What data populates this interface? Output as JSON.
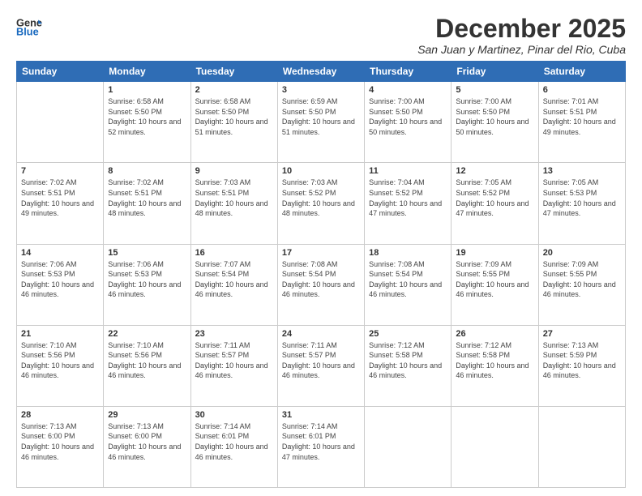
{
  "header": {
    "logo_general": "General",
    "logo_blue": "Blue",
    "month_title": "December 2025",
    "location": "San Juan y Martinez, Pinar del Rio, Cuba"
  },
  "days_of_week": [
    "Sunday",
    "Monday",
    "Tuesday",
    "Wednesday",
    "Thursday",
    "Friday",
    "Saturday"
  ],
  "weeks": [
    [
      {
        "day": "",
        "sunrise": "",
        "sunset": "",
        "daylight": ""
      },
      {
        "day": "1",
        "sunrise": "Sunrise: 6:58 AM",
        "sunset": "Sunset: 5:50 PM",
        "daylight": "Daylight: 10 hours and 52 minutes."
      },
      {
        "day": "2",
        "sunrise": "Sunrise: 6:58 AM",
        "sunset": "Sunset: 5:50 PM",
        "daylight": "Daylight: 10 hours and 51 minutes."
      },
      {
        "day": "3",
        "sunrise": "Sunrise: 6:59 AM",
        "sunset": "Sunset: 5:50 PM",
        "daylight": "Daylight: 10 hours and 51 minutes."
      },
      {
        "day": "4",
        "sunrise": "Sunrise: 7:00 AM",
        "sunset": "Sunset: 5:50 PM",
        "daylight": "Daylight: 10 hours and 50 minutes."
      },
      {
        "day": "5",
        "sunrise": "Sunrise: 7:00 AM",
        "sunset": "Sunset: 5:50 PM",
        "daylight": "Daylight: 10 hours and 50 minutes."
      },
      {
        "day": "6",
        "sunrise": "Sunrise: 7:01 AM",
        "sunset": "Sunset: 5:51 PM",
        "daylight": "Daylight: 10 hours and 49 minutes."
      }
    ],
    [
      {
        "day": "7",
        "sunrise": "Sunrise: 7:02 AM",
        "sunset": "Sunset: 5:51 PM",
        "daylight": "Daylight: 10 hours and 49 minutes."
      },
      {
        "day": "8",
        "sunrise": "Sunrise: 7:02 AM",
        "sunset": "Sunset: 5:51 PM",
        "daylight": "Daylight: 10 hours and 48 minutes."
      },
      {
        "day": "9",
        "sunrise": "Sunrise: 7:03 AM",
        "sunset": "Sunset: 5:51 PM",
        "daylight": "Daylight: 10 hours and 48 minutes."
      },
      {
        "day": "10",
        "sunrise": "Sunrise: 7:03 AM",
        "sunset": "Sunset: 5:52 PM",
        "daylight": "Daylight: 10 hours and 48 minutes."
      },
      {
        "day": "11",
        "sunrise": "Sunrise: 7:04 AM",
        "sunset": "Sunset: 5:52 PM",
        "daylight": "Daylight: 10 hours and 47 minutes."
      },
      {
        "day": "12",
        "sunrise": "Sunrise: 7:05 AM",
        "sunset": "Sunset: 5:52 PM",
        "daylight": "Daylight: 10 hours and 47 minutes."
      },
      {
        "day": "13",
        "sunrise": "Sunrise: 7:05 AM",
        "sunset": "Sunset: 5:53 PM",
        "daylight": "Daylight: 10 hours and 47 minutes."
      }
    ],
    [
      {
        "day": "14",
        "sunrise": "Sunrise: 7:06 AM",
        "sunset": "Sunset: 5:53 PM",
        "daylight": "Daylight: 10 hours and 46 minutes."
      },
      {
        "day": "15",
        "sunrise": "Sunrise: 7:06 AM",
        "sunset": "Sunset: 5:53 PM",
        "daylight": "Daylight: 10 hours and 46 minutes."
      },
      {
        "day": "16",
        "sunrise": "Sunrise: 7:07 AM",
        "sunset": "Sunset: 5:54 PM",
        "daylight": "Daylight: 10 hours and 46 minutes."
      },
      {
        "day": "17",
        "sunrise": "Sunrise: 7:08 AM",
        "sunset": "Sunset: 5:54 PM",
        "daylight": "Daylight: 10 hours and 46 minutes."
      },
      {
        "day": "18",
        "sunrise": "Sunrise: 7:08 AM",
        "sunset": "Sunset: 5:54 PM",
        "daylight": "Daylight: 10 hours and 46 minutes."
      },
      {
        "day": "19",
        "sunrise": "Sunrise: 7:09 AM",
        "sunset": "Sunset: 5:55 PM",
        "daylight": "Daylight: 10 hours and 46 minutes."
      },
      {
        "day": "20",
        "sunrise": "Sunrise: 7:09 AM",
        "sunset": "Sunset: 5:55 PM",
        "daylight": "Daylight: 10 hours and 46 minutes."
      }
    ],
    [
      {
        "day": "21",
        "sunrise": "Sunrise: 7:10 AM",
        "sunset": "Sunset: 5:56 PM",
        "daylight": "Daylight: 10 hours and 46 minutes."
      },
      {
        "day": "22",
        "sunrise": "Sunrise: 7:10 AM",
        "sunset": "Sunset: 5:56 PM",
        "daylight": "Daylight: 10 hours and 46 minutes."
      },
      {
        "day": "23",
        "sunrise": "Sunrise: 7:11 AM",
        "sunset": "Sunset: 5:57 PM",
        "daylight": "Daylight: 10 hours and 46 minutes."
      },
      {
        "day": "24",
        "sunrise": "Sunrise: 7:11 AM",
        "sunset": "Sunset: 5:57 PM",
        "daylight": "Daylight: 10 hours and 46 minutes."
      },
      {
        "day": "25",
        "sunrise": "Sunrise: 7:12 AM",
        "sunset": "Sunset: 5:58 PM",
        "daylight": "Daylight: 10 hours and 46 minutes."
      },
      {
        "day": "26",
        "sunrise": "Sunrise: 7:12 AM",
        "sunset": "Sunset: 5:58 PM",
        "daylight": "Daylight: 10 hours and 46 minutes."
      },
      {
        "day": "27",
        "sunrise": "Sunrise: 7:13 AM",
        "sunset": "Sunset: 5:59 PM",
        "daylight": "Daylight: 10 hours and 46 minutes."
      }
    ],
    [
      {
        "day": "28",
        "sunrise": "Sunrise: 7:13 AM",
        "sunset": "Sunset: 6:00 PM",
        "daylight": "Daylight: 10 hours and 46 minutes."
      },
      {
        "day": "29",
        "sunrise": "Sunrise: 7:13 AM",
        "sunset": "Sunset: 6:00 PM",
        "daylight": "Daylight: 10 hours and 46 minutes."
      },
      {
        "day": "30",
        "sunrise": "Sunrise: 7:14 AM",
        "sunset": "Sunset: 6:01 PM",
        "daylight": "Daylight: 10 hours and 46 minutes."
      },
      {
        "day": "31",
        "sunrise": "Sunrise: 7:14 AM",
        "sunset": "Sunset: 6:01 PM",
        "daylight": "Daylight: 10 hours and 47 minutes."
      },
      {
        "day": "",
        "sunrise": "",
        "sunset": "",
        "daylight": ""
      },
      {
        "day": "",
        "sunrise": "",
        "sunset": "",
        "daylight": ""
      },
      {
        "day": "",
        "sunrise": "",
        "sunset": "",
        "daylight": ""
      }
    ]
  ]
}
